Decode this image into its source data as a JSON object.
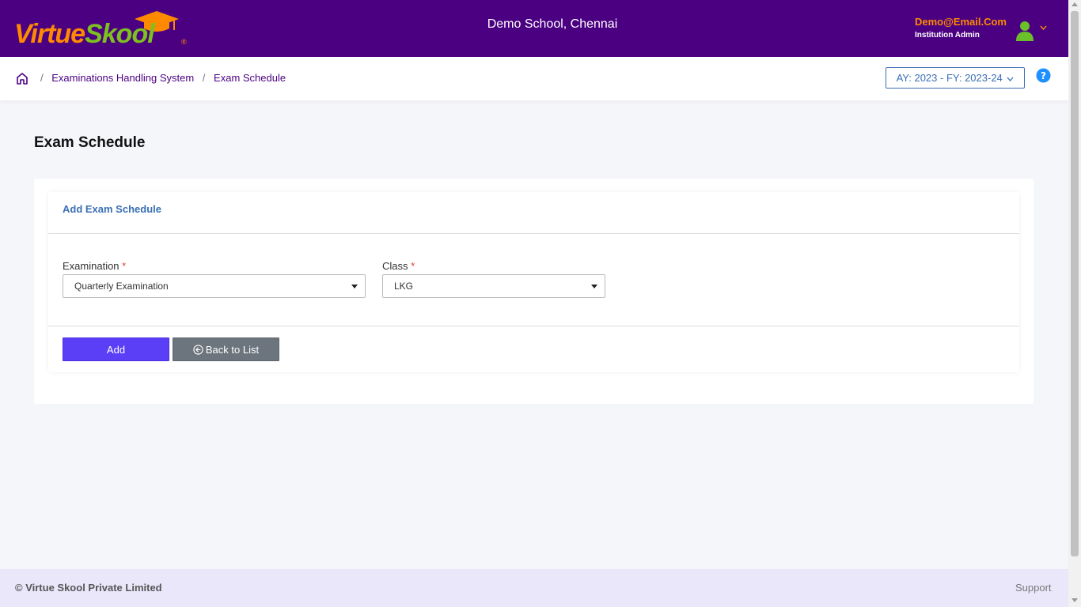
{
  "header": {
    "logo": {
      "part1": "Virtue",
      "part2": "Skool",
      "reg": "®"
    },
    "school_name": "Demo School, Chennai",
    "user_email": "Demo@Email.Com",
    "user_role": "Institution Admin"
  },
  "breadcrumb": {
    "items": [
      "Examinations Handling System",
      "Exam Schedule"
    ],
    "separator": "/"
  },
  "academic_year": "AY: 2023 - FY: 2023-24",
  "page_title": "Exam Schedule",
  "form": {
    "title": "Add Exam Schedule",
    "examination_label": "Examination",
    "examination_value": "Quarterly Examination",
    "class_label": "Class",
    "class_value": "LKG",
    "required_mark": "*",
    "add_label": "Add",
    "back_label": "Back to List"
  },
  "footer": {
    "copyright": "© Virtue Skool Private Limited",
    "support": "Support"
  },
  "colors": {
    "header_bg": "#4b0082",
    "brand_orange": "#ff8a00",
    "brand_green": "#7dc020",
    "primary_button": "#5a3ff7",
    "secondary_button": "#6c757d",
    "link_blue": "#3a6fb5",
    "footer_bg": "#ebe7fb"
  },
  "icons": [
    "graduation-cap-icon",
    "user-avatar-icon",
    "chevron-down-icon",
    "home-icon",
    "help-icon",
    "back-arrow-icon"
  ]
}
